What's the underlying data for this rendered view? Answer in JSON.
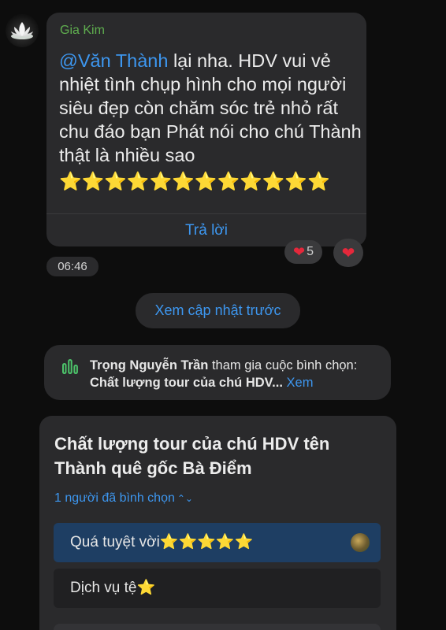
{
  "message": {
    "sender": "Gia Kim",
    "mention": "@Văn Thành",
    "body": " lại nha. HDV vui vẻ nhiệt tình chụp hình cho mọi người siêu đẹp còn chăm sóc trẻ nhỏ rất chu đáo bạn Phát nói cho chú Thành thật là nhiều sao",
    "stars": "⭐⭐⭐⭐⭐⭐⭐⭐⭐⭐⭐⭐",
    "reply_label": "Trả lời",
    "reaction_count": "5",
    "reaction_icon": "heart",
    "time": "06:46"
  },
  "see_previous_label": "Xem cập nhật trước",
  "poll_notice": {
    "user": "Trọng Nguyễn Trần",
    "action": " tham gia cuộc bình chọn: ",
    "poll_name": "Chất lượng tour của chú HDV...",
    "see_more": " Xem"
  },
  "poll": {
    "title": "Chất lượng tour của chú HDV tên Thành quê gốc Bà Điểm",
    "voters_label": "1 người đã bình chọn",
    "options": [
      {
        "label": "Quá tuyệt vời",
        "stars": "⭐⭐⭐⭐⭐",
        "selected": true
      },
      {
        "label": "Dịch vụ tệ",
        "stars": "⭐",
        "selected": false
      }
    ]
  },
  "colors": {
    "accent": "#3d97f0",
    "sender": "#5fae4f",
    "heart": "#e5283b",
    "star": "#f7c433",
    "selected_option": "#1e3e63"
  }
}
